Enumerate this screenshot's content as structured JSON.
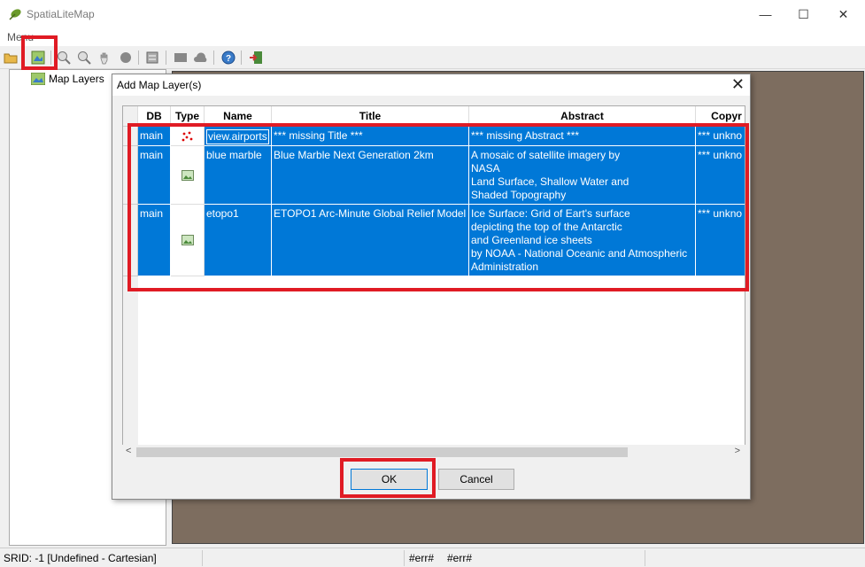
{
  "window": {
    "title": "SpatiaLiteMap",
    "minimize": "—",
    "maximize": "☐",
    "close": "✕"
  },
  "menubar": {
    "menu": "Menu"
  },
  "toolbar": {
    "items": [
      "open-folder-icon",
      "add-layer-icon",
      "zoom-in-icon",
      "zoom-out-icon",
      "pan-hand-icon",
      "circle-icon",
      "settings-icon",
      "square-icon",
      "cloud-icon",
      "info-icon",
      "exit-icon"
    ]
  },
  "tree": {
    "root_label": "Map Layers"
  },
  "status": {
    "srid": "SRID: -1 [Undefined - Cartesian]",
    "err1": "#err#",
    "err2": "#err#"
  },
  "dialog": {
    "title": "Add Map Layer(s)",
    "close": "✕",
    "columns": [
      "DB",
      "Type",
      "Name",
      "Title",
      "Abstract",
      "Copyr"
    ],
    "rows": [
      {
        "db": "main",
        "type": "vector-points-icon",
        "name": "view.airports",
        "title": "*** missing Title ***",
        "abstract": "*** missing Abstract ***",
        "copyright": "*** unkno"
      },
      {
        "db": "main",
        "type": "raster-image-icon",
        "name": "blue marble",
        "title": "Blue Marble Next Generation 2km",
        "abstract": "A mosaic of satellite imagery by\nNASA\nLand Surface, Shallow Water and\nShaded Topography",
        "copyright": "*** unkno"
      },
      {
        "db": "main",
        "type": "raster-image-icon",
        "name": "etopo1",
        "title": "ETOPO1 Arc-Minute Global Relief Model",
        "abstract": "Ice Surface: Grid of Eart's surface\ndepicting the top of the Antarctic\nand Greenland ice sheets\nby NOAA - National Oceanic and Atmospheric\nAdministration",
        "copyright": "*** unkno"
      }
    ],
    "scroll_left": "<",
    "scroll_right": ">",
    "ok_label": "OK",
    "cancel_label": "Cancel"
  },
  "colors": {
    "selection": "#0078d7",
    "highlight": "#e01b24",
    "map_bg": "#7d6d5f"
  }
}
